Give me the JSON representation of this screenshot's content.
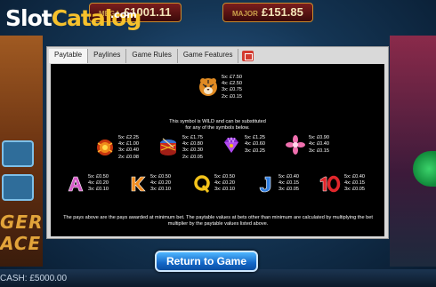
{
  "logo": {
    "slot": "Slot",
    "catalog": "Catalog",
    "com": ".com"
  },
  "background": {
    "jackpots": [
      {
        "name": "MEGA",
        "value": "£1001.11"
      },
      {
        "name": "MAJOR",
        "value": "£151.85"
      }
    ],
    "left_title": "GER",
    "left_title2": "ACE",
    "cash": "CASH: £5000.00"
  },
  "tabs": [
    {
      "label": "Paytable",
      "active": true
    },
    {
      "label": "Paylines"
    },
    {
      "label": "Game Rules"
    },
    {
      "label": "Game Features"
    }
  ],
  "tabs_icon": "help-book-icon",
  "paytable": {
    "wild": {
      "icon": "tiger-icon",
      "pays": [
        "5x: £7.50",
        "4x: £2.50",
        "3x: £0.75",
        "2x: £0.15"
      ],
      "note1": "This symbol is WILD and can be substituted",
      "note2": "for any of the symbols below."
    },
    "high": [
      {
        "icon": "fire-orb-icon",
        "pays": [
          "5x: £2.25",
          "4x: £1.00",
          "3x: £0.40",
          "2x: £0.08"
        ]
      },
      {
        "icon": "drum-icon",
        "pays": [
          "5x: £1.75",
          "4x: £0.80",
          "3x: £0.30",
          "2x: £0.05"
        ]
      },
      {
        "icon": "purple-gem-icon",
        "pays": [
          "5x: £1.25",
          "4x: £0.60",
          "3x: £0.25"
        ]
      },
      {
        "icon": "pink-flower-icon",
        "pays": [
          "5x: £0.90",
          "4x: £0.40",
          "3x: £0.15"
        ]
      }
    ],
    "low": [
      {
        "icon": "letter-a-icon",
        "glyph": "A",
        "color": "#d65ac8",
        "pays": [
          "5x: £0.50",
          "4x: £0.20",
          "3x: £0.10"
        ]
      },
      {
        "icon": "letter-k-icon",
        "glyph": "K",
        "color": "#f08a1c",
        "pays": [
          "5x: £0.50",
          "4x: £0.20",
          "3x: £0.10"
        ]
      },
      {
        "icon": "letter-q-icon",
        "glyph": "Q",
        "color": "#f2c21a",
        "pays": [
          "5x: £0.50",
          "4x: £0.20",
          "3x: £0.10"
        ]
      },
      {
        "icon": "letter-j-icon",
        "glyph": "J",
        "color": "#2f7de0",
        "pays": [
          "5x: £0.40",
          "4x: £0.15",
          "3x: £0.05"
        ]
      },
      {
        "icon": "number-10-icon",
        "glyph": "10",
        "color": "#e0262b",
        "pays": [
          "5x: £0.40",
          "4x: £0.15",
          "3x: £0.05"
        ]
      }
    ],
    "footnote": "The pays above are the pays awarded at minimum bet. The paytable values at bets other than minimum are calculated by multiplying the bet multiplier by the paytable values listed above."
  },
  "return_button": "Return to Game"
}
